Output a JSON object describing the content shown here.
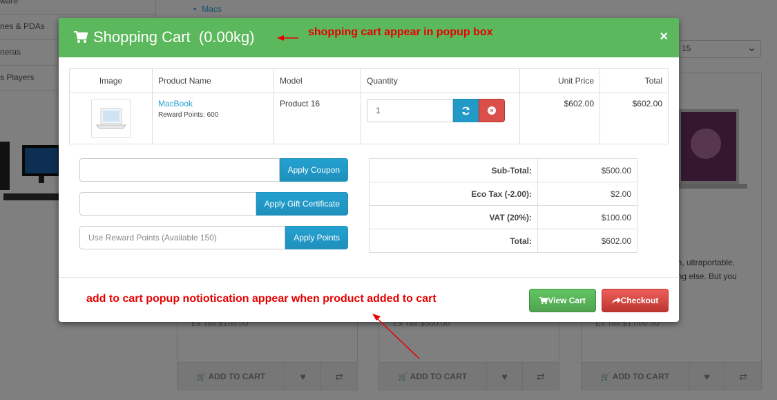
{
  "background": {
    "sidebar_items": [
      "ware",
      "nes & PDAs",
      "neras",
      "s Players"
    ],
    "category_link": "Macs",
    "sort_select_value": "15",
    "product_cards": [
      {
        "ex_tax": "Ex Tax:$100.00",
        "add_to_cart": "ADD TO CART"
      },
      {
        "ex_tax": "Ex Tax:$500.00",
        "add_to_cart": "ADD TO CART"
      },
      {
        "ex_tax": "Ex Tax:$1,000.00",
        "add_to_cart": "ADD TO CART"
      }
    ],
    "description_line1": "in, ultraportable,",
    "description_line2": "ing else. But you"
  },
  "modal": {
    "title": "Shopping Cart  (0.00kg)",
    "close": "×",
    "header_color": "#5cb85c",
    "table": {
      "headers": [
        "Image",
        "Product Name",
        "Model",
        "Quantity",
        "Unit Price",
        "Total"
      ],
      "rows": [
        {
          "product_name": "MacBook",
          "reward_points": "Reward Points: 600",
          "model": "Product 16",
          "quantity": "1",
          "unit_price": "$602.00",
          "total": "$602.00"
        }
      ]
    },
    "coupon": {
      "placeholder": "",
      "button": "Apply Coupon"
    },
    "gift": {
      "placeholder": "",
      "button": "Apply Gift Certificate"
    },
    "reward": {
      "placeholder": "Use Reward Points (Available 150)",
      "button": "Apply Points"
    },
    "totals": [
      {
        "label": "Sub-Total:",
        "value": "$500.00"
      },
      {
        "label": "Eco Tax (-2.00):",
        "value": "$2.00"
      },
      {
        "label": "VAT (20%):",
        "value": "$100.00"
      },
      {
        "label": "Total:",
        "value": "$602.00"
      }
    ],
    "footer": {
      "view_cart": "View Cart",
      "checkout": "Checkout"
    }
  },
  "annotations": {
    "top": "shopping cart appear in popup box",
    "bottom": "add to cart popup notiotication appear when product added to cart",
    "color": "#e60000"
  }
}
